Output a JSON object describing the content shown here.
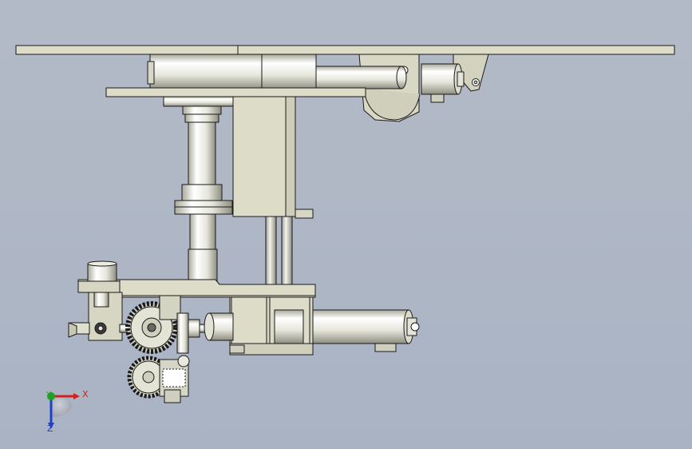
{
  "viewport": {
    "background_top": "#b2bac7",
    "background_bottom": "#a9b3c4",
    "part_color": "#ddddc9",
    "edge_color": "#1a1a1a"
  },
  "triad": {
    "x_label": "X",
    "y_label": "Y",
    "z_label": "Z",
    "x_color": "#d42020",
    "y_color": "#20a020",
    "z_color": "#2040c8"
  }
}
